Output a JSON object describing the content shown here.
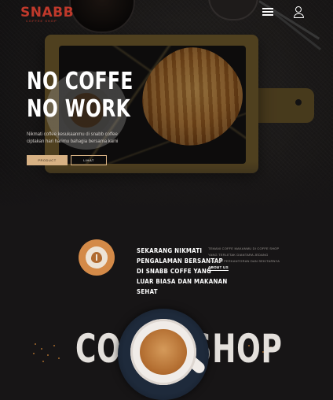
{
  "brand": {
    "name": "SNABB",
    "tagline": "COFFEE SHOP"
  },
  "hero": {
    "title_line1": "NO COFFE",
    "title_line2": "NO WORK",
    "subtext": "Nikmati coffee kesukaanmu di snabb coffee ciptakan hari harimu bahagia bersama kami",
    "primary_button": "PRODUCT",
    "secondary_button": "LIHAT"
  },
  "about": {
    "heading_lines": [
      "SEKARANG NIKMATI",
      "PENGALAMAN BERSANTAP",
      "DI SNABB COFFE YANG",
      "LUAR BIASA DAN MAKANAN",
      "SEHAT"
    ],
    "text": "TEMANI COFFE MAKANMU DI COFFE SHOP YANG TERLETAK DIANTARA JEDANG GEDUNG PERKANTORAN DAN SEKITARNYA SERTA",
    "link": "ABOUT US"
  },
  "showcase": {
    "big_text": "COFFE SHOP"
  },
  "icons": [
    "menu-icon",
    "user-icon",
    "latte-art-icon",
    "coffee-cup-icon"
  ],
  "colors": {
    "accent": "#d7b184",
    "brand_red": "#c0392b",
    "background": "#171516"
  }
}
